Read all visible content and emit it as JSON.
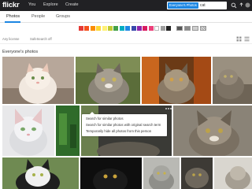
{
  "header": {
    "logo": "flickr",
    "nav": [
      "You",
      "Explore",
      "Create"
    ],
    "search": {
      "scope": "Everyone's Photos",
      "query": "cat",
      "icon": "search-icon"
    },
    "right_icons": [
      "upload-icon",
      "bell-icon",
      "avatar"
    ]
  },
  "tabs": [
    {
      "label": "Photos",
      "active": true
    },
    {
      "label": "People",
      "active": false
    },
    {
      "label": "Groups",
      "active": false
    }
  ],
  "color_filters": {
    "swatches": [
      "#e53935",
      "#f4511e",
      "#fb8c00",
      "#fdd835",
      "#fff176",
      "#c0ca33",
      "#43a047",
      "#00acc1",
      "#1e88e5",
      "#3949ab",
      "#8e24aa",
      "#d81b60",
      "#ec407a",
      "#ffffff",
      "#9e9e9e",
      "#212121"
    ],
    "pattern_filters": [
      "black-white",
      "shallow-depth",
      "minimalist",
      "patterns"
    ]
  },
  "options": {
    "license": "Any license",
    "safesearch": "SafeSearch off",
    "view_icons": [
      "grid-view-icon",
      "list-view-icon"
    ]
  },
  "section": {
    "title": "Everyone's photos"
  },
  "context_menu": {
    "more_icon": "more-icon",
    "items": [
      "Search for similar photos",
      "Search for similar photos with original search term",
      "Temporarily hide all photos from this person"
    ]
  },
  "colors": {
    "header_bg": "#212124",
    "accent": "#1c86e2"
  }
}
